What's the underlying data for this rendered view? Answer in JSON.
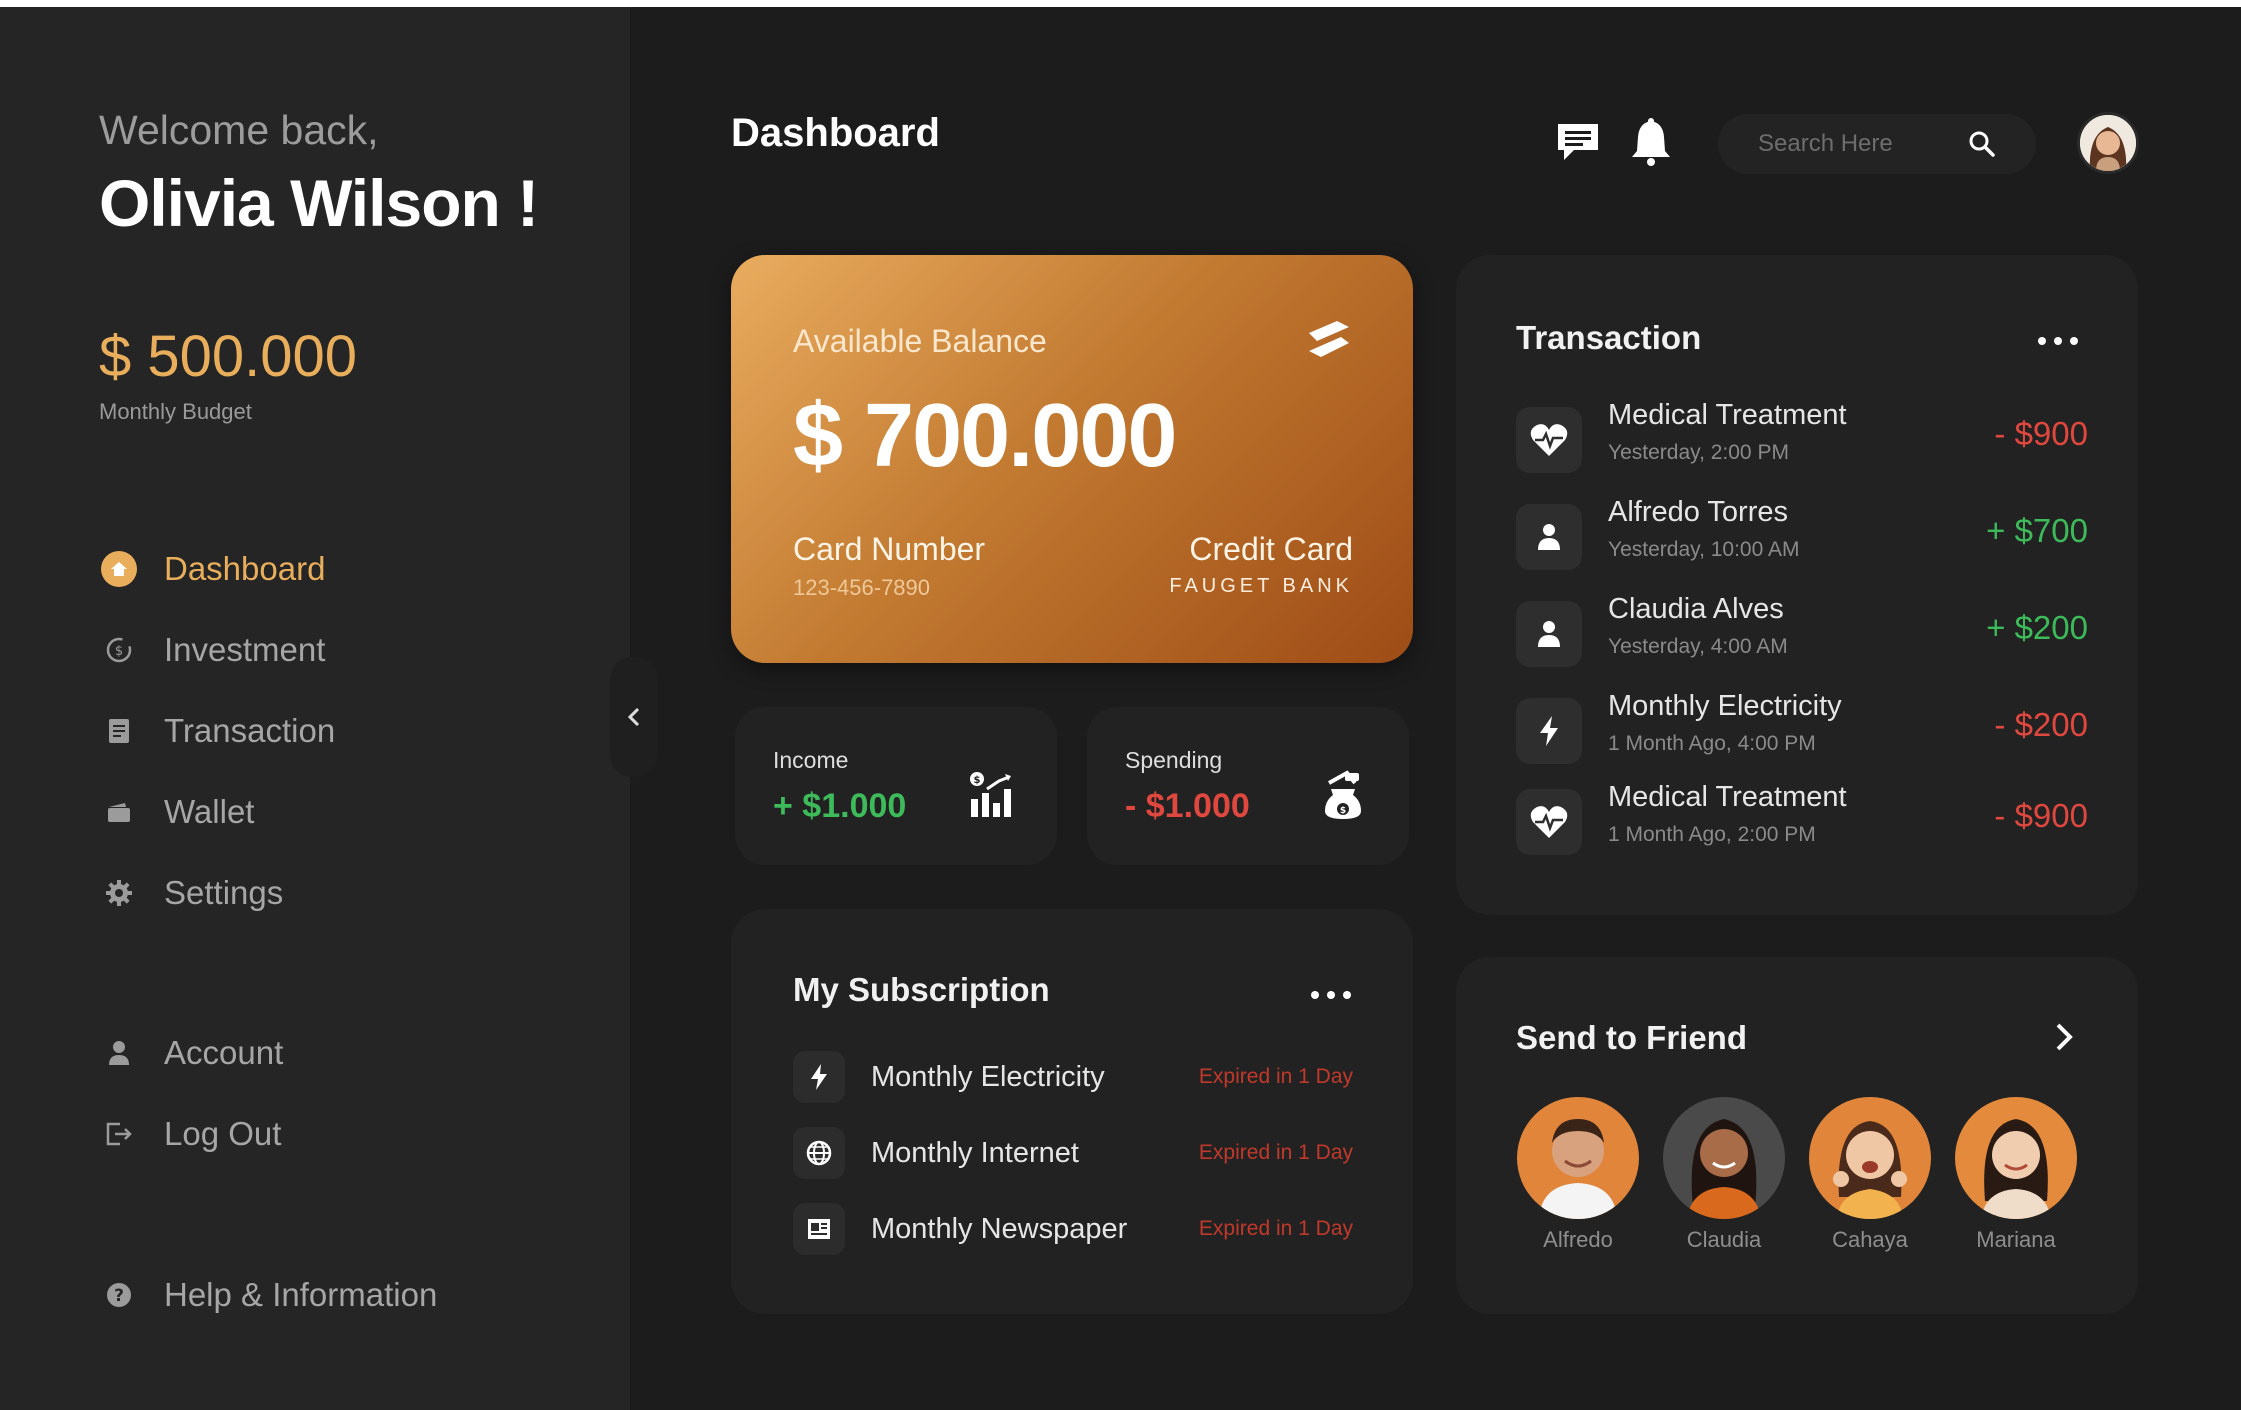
{
  "sidebar": {
    "welcome": "Welcome back,",
    "user_name": "Olivia Wilson !",
    "budget_amount": "$ 500.000",
    "budget_label": "Monthly Budget",
    "nav": [
      {
        "label": "Dashboard",
        "icon": "home-icon",
        "active": true
      },
      {
        "label": "Investment",
        "icon": "investment-icon"
      },
      {
        "label": "Transaction",
        "icon": "transaction-icon"
      },
      {
        "label": "Wallet",
        "icon": "wallet-icon"
      },
      {
        "label": "Settings",
        "icon": "gear-icon"
      }
    ],
    "account": [
      {
        "label": "Account",
        "icon": "user-icon"
      },
      {
        "label": "Log Out",
        "icon": "logout-icon"
      }
    ],
    "help": {
      "label": "Help & Information",
      "icon": "help-icon"
    }
  },
  "header": {
    "title": "Dashboard",
    "search_placeholder": "Search Here"
  },
  "balance_card": {
    "label": "Available Balance",
    "amount": "$ 700.000",
    "card_number_label": "Card Number",
    "card_number": "123-456-7890",
    "card_type": "Credit Card",
    "bank": "FAUGET BANK"
  },
  "income": {
    "label": "Income",
    "value": "+ $1.000"
  },
  "spending": {
    "label": "Spending",
    "value": "- $1.000"
  },
  "subscription": {
    "title": "My Subscription",
    "items": [
      {
        "name": "Monthly Electricity",
        "status": "Expired in 1 Day",
        "icon": "lightning-icon"
      },
      {
        "name": "Monthly Internet",
        "status": "Expired in 1 Day",
        "icon": "globe-icon"
      },
      {
        "name": "Monthly Newspaper",
        "status": "Expired in 1 Day",
        "icon": "newspaper-icon"
      }
    ]
  },
  "transactions": {
    "title": "Transaction",
    "items": [
      {
        "name": "Medical Treatment",
        "time": "Yesterday, 2:00 PM",
        "amount": "- $900",
        "type": "neg",
        "icon": "heart-icon"
      },
      {
        "name": "Alfredo Torres",
        "time": "Yesterday, 10:00 AM",
        "amount": "+ $700",
        "type": "pos",
        "icon": "user-icon"
      },
      {
        "name": "Claudia Alves",
        "time": "Yesterday, 4:00 AM",
        "amount": "+ $200",
        "type": "pos",
        "icon": "user-icon"
      },
      {
        "name": "Monthly Electricity",
        "time": "1 Month Ago, 4:00 PM",
        "amount": "- $200",
        "type": "neg",
        "icon": "lightning-icon"
      },
      {
        "name": "Medical Treatment",
        "time": "1 Month Ago, 2:00 PM",
        "amount": "- $900",
        "type": "neg",
        "icon": "heart-icon"
      }
    ]
  },
  "friends": {
    "title": "Send to Friend",
    "items": [
      {
        "name": "Alfredo"
      },
      {
        "name": "Claudia"
      },
      {
        "name": "Cahaya"
      },
      {
        "name": "Mariana"
      }
    ]
  },
  "colors": {
    "accent": "#e8ae5b",
    "positive": "#3dbb5b",
    "negative": "#e0483f",
    "background": "#1c1c1c",
    "sidebar": "#252525"
  }
}
